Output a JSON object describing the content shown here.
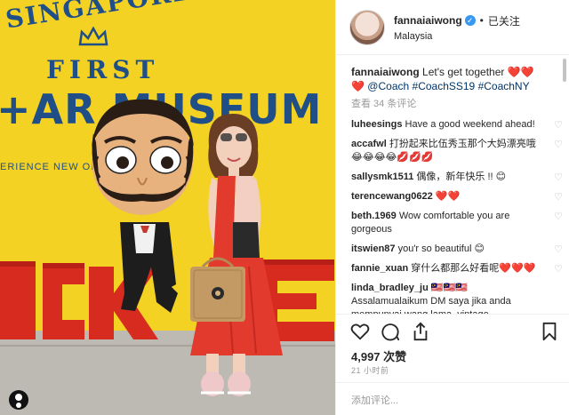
{
  "photo": {
    "wall_text": {
      "line1": "SINGAPORE'S",
      "line2": "FIRST",
      "line3": "+AR MUSEUM",
      "line4": "ERIENCE  NEW OPTICAL ILLUSI"
    }
  },
  "post": {
    "username": "fannaiaiwong",
    "follow_status": "已关注",
    "location": "Malaysia",
    "caption": {
      "username": "fannaiaiwong",
      "text": "Let's get together",
      "emoji": "❤️❤️❤️",
      "mention": "@Coach",
      "hashtags": "#CoachSS19 #CoachNY"
    },
    "view_all_comments": "查看 34 条评论",
    "comments": [
      {
        "user": "luheesings",
        "text": "Have a good weekend ahead!"
      },
      {
        "user": "accafwl",
        "text": "打扮起来比伍秀玉那个大妈漂亮哦😂😂😂😂💋💋💋"
      },
      {
        "user": "sallysmk1511",
        "text": "偶像，新年快乐 !! 😊"
      },
      {
        "user": "terencewang0622",
        "text": "❤️❤️"
      },
      {
        "user": "beth.1969",
        "text": "Wow comfortable you are gorgeous"
      },
      {
        "user": "itswien87",
        "text": "you'r so beautiful 😊"
      },
      {
        "user": "fannie_xuan",
        "text": "穿什么都那么好看呢❤️❤️❤️"
      },
      {
        "user": "linda_bradley_ju",
        "text": "🇲🇾🇲🇾🇲🇾"
      },
      {
        "user": "",
        "text": "Assalamualaikum DM saya jika anda mempunyai wang lama, vintage"
      }
    ],
    "likes": "4,997 次赞",
    "time_ago": "21 小时前",
    "add_comment_placeholder": "添加评论..."
  },
  "icons": [
    "heart-icon",
    "comment-icon",
    "share-icon",
    "bookmark-icon",
    "verified-icon",
    "user-tag-icon"
  ],
  "colors": {
    "wall_yellow": "#f4d223",
    "wall_text_blue": "#1f4f86",
    "letters_red": "#d72b20",
    "dress_red": "#e23a2c",
    "verified_blue": "#3897f0",
    "hashtag_blue": "#003569",
    "heart_red": "#e0245e"
  }
}
